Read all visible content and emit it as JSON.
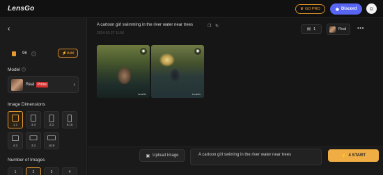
{
  "header": {
    "logo": "LensGo",
    "gopro_label": "GO PRO",
    "discord_label": "Discord"
  },
  "sidebar": {
    "credits": "96",
    "add_label": "Add",
    "model_section": "Model",
    "model_name": "Real",
    "model_badge": "Prime",
    "dims_section": "Image Dimensions",
    "dimensions": [
      "1:1",
      "3:4",
      "2:3",
      "9:16",
      "4:3",
      "3:2",
      "16:9"
    ],
    "selected_dimension": "1:1",
    "num_images_section": "Number of Images",
    "num_images_options": [
      "1",
      "2",
      "3",
      "4"
    ],
    "selected_num_images": "2"
  },
  "main": {
    "prompt_title": "A cartoon girl swimming in the river water near trees",
    "date": "2024-03-27 11:56",
    "image_count": "1",
    "model_label": "Real",
    "images": [
      {
        "watermark": "LensGo"
      },
      {
        "watermark": "LensGo"
      }
    ]
  },
  "bottom": {
    "upload_label": "Upload Image",
    "prompt_text": "A cartoon girl swiming in the river water near trees",
    "start_label": "4 START"
  },
  "colors": {
    "accent": "#f0ad44",
    "discord": "#5865f2",
    "badge": "#d32f2f"
  }
}
